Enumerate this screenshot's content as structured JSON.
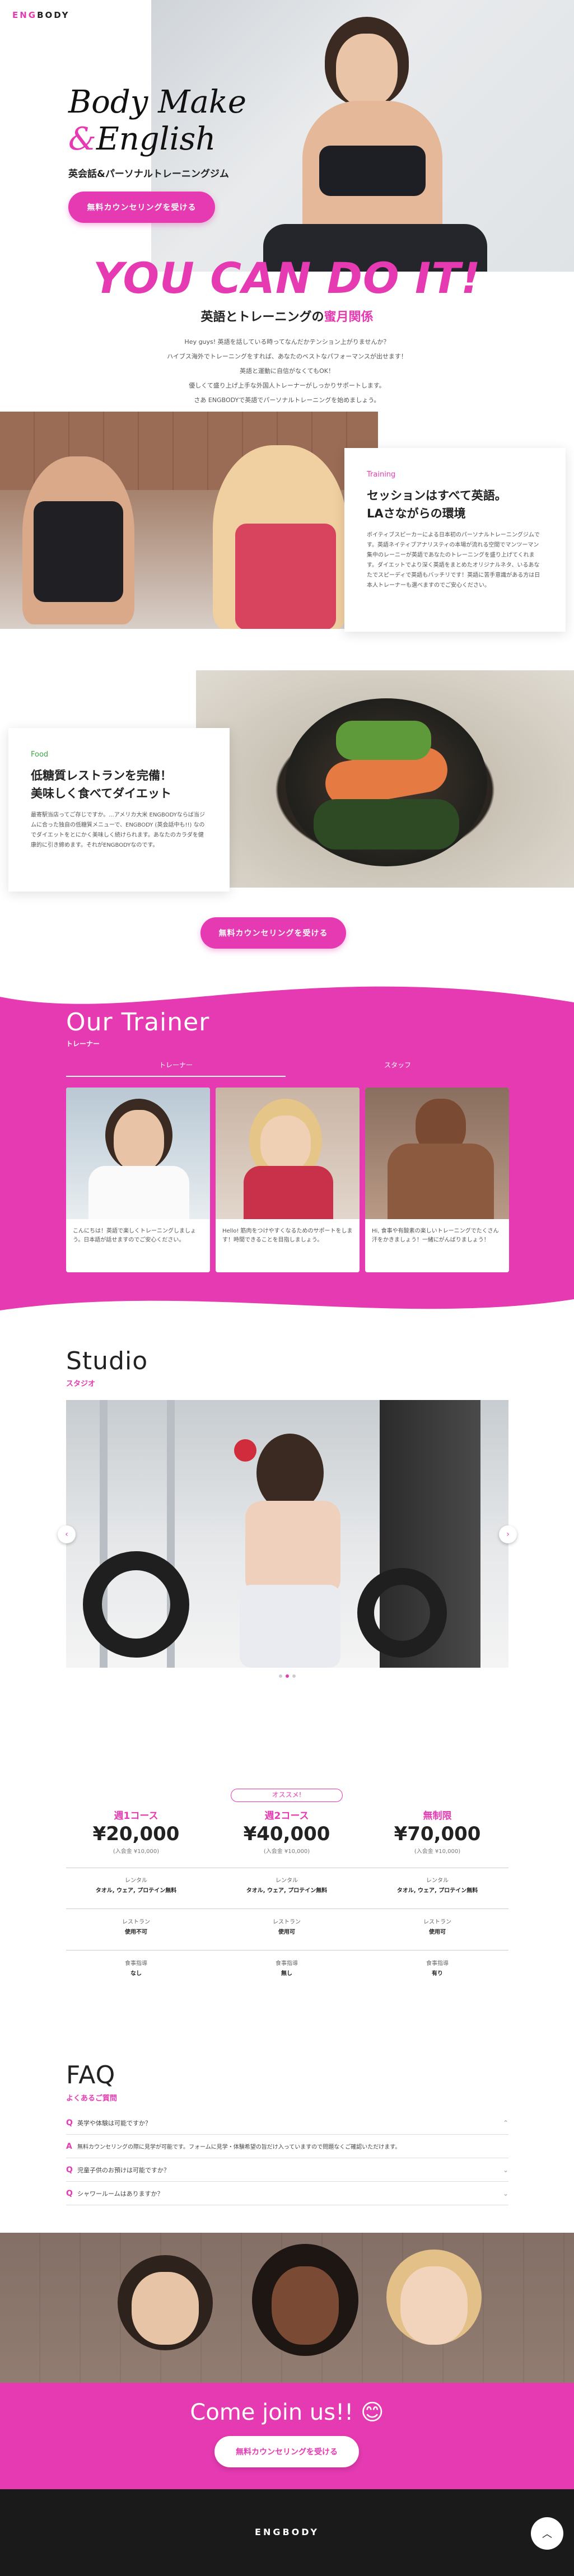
{
  "header": {
    "logo_eng": "ENG",
    "logo_body": "BODY"
  },
  "hero": {
    "title_line1": "Body Make",
    "title_amp": "&",
    "title_line2": "English",
    "subtitle": "英会話&パーソナルトレーニングジム",
    "cta": "無料カウンセリングを受ける"
  },
  "intro": {
    "headline": "YOU CAN DO IT!",
    "sub_prefix": "英語とトレーニングの",
    "sub_highlight": "蜜月関係",
    "lines": [
      "Hey guys! 英語を話している時ってなんだかテンション上がりませんか？",
      "ハイブス海外でトレーニングをすれば、あなたのベストなパフォーマンスが出せます！",
      "英語と運動に自信がなくてもOK！",
      "優しくて盛り上げ上手な外国人トレーナーがしっかりサポートします。",
      "さあ ENGBODYで英語でパーソナルトレーニングを始めましょう。"
    ]
  },
  "training": {
    "label": "Training",
    "title1": "セッションはすべて英語。",
    "title2": "LAさながらの環境",
    "body": "ボイティブスピーカーによる日本初のパーソナルトレーニングジムです。英語ネイティブアナリスティの本場が流れる空間でマンツーマン集中のレーニーが英語であなたのトレーニングを盛り上げてくれます。ダイエットでより深く英語をまとめたオリジナルネタ、いるあなたでスピーディで英語もバッチリです！英語に苦手意識がある方は日本人トレーナーも選べますのでご安心ください。"
  },
  "food": {
    "label": "Food",
    "title1": "低糖質レストランを完備！",
    "title2": "美味しく食べてダイエット",
    "body": "最寄駅当店ってご存じですか。...アメリカ大米 ENGBODYならば当ジムに合った独自の低糖質メニューで、ENGBODY (英会話中も!!) なのでダイエットをとにかく美味しく続けられます。あなたのカラダを健康的に引き締めます。それがENGBODYなのです。"
  },
  "cta2": "無料カウンセリングを受ける",
  "trainer": {
    "title": "Our Trainer",
    "sub": "トレーナー",
    "tab1": "トレーナー",
    "tab2": "スタッフ",
    "cards": [
      "こんにちは！英語で楽しくトレーニングしましょう。日本語が話せますのでご安心ください。",
      "Hello! 筋肉をつけやすくなるためのサポートをします！時間できることを目指しましょう。",
      "Hi, 食事や有酸素の楽しいトレーニングでたくさん汗をかきましょう！一緒にがんばりましょう！"
    ]
  },
  "studio": {
    "title": "Studio",
    "sub": "スタジオ"
  },
  "plans": {
    "badge": "オススメ!",
    "items": [
      {
        "name": "週1コース",
        "price": "¥20,000",
        "note": "(入会金 ¥10,000)",
        "r1": "レンタル",
        "r1v": "タオル, ウェア, プロテイン無料",
        "r2": "レストラン",
        "r2v": "使用不可",
        "r3": "食事指導",
        "r3v": "なし"
      },
      {
        "name": "週2コース",
        "price": "¥40,000",
        "note": "(入会金 ¥10,000)",
        "r1": "レンタル",
        "r1v": "タオル, ウェア, プロテイン無料",
        "r2": "レストラン",
        "r2v": "使用可",
        "r3": "食事指導",
        "r3v": "無し"
      },
      {
        "name": "無制限",
        "price": "¥70,000",
        "note": "(入会金 ¥10,000)",
        "r1": "レンタル",
        "r1v": "タオル, ウェア, プロテイン無料",
        "r2": "レストラン",
        "r2v": "使用可",
        "r3": "食事指導",
        "r3v": "有り"
      }
    ]
  },
  "faq": {
    "title": "FAQ",
    "sub": "よくあるご質問",
    "q": [
      "英学や体験は可能ですか？",
      "無料カウンセリングの際に見学が可能です。フォームに見学・体験希望の旨だけ入っていますので問題なくご確認いただけます。",
      "児童子供のお預けは可能ですか？",
      "シャワールームはありますか？"
    ],
    "mark_q": "Q",
    "mark_a": "A"
  },
  "join": {
    "title": "Come join us!! 😊",
    "cta": "無料カウンセリングを受ける"
  },
  "footer": {
    "logo": "ENGBODY",
    "top_icon": "arrow-up-icon"
  },
  "colors": {
    "accent": "#e63ab2",
    "dark": "#1a1a1a"
  }
}
